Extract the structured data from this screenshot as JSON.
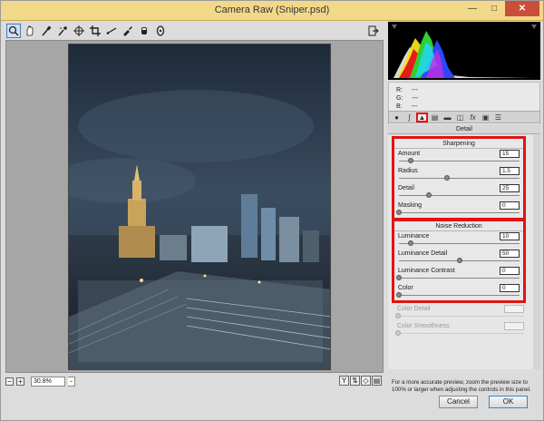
{
  "window": {
    "title": "Camera Raw (Sniper.psd)"
  },
  "toolbar": {
    "tools": [
      "zoom-icon",
      "hand-icon",
      "white-balance-icon",
      "color-sampler-icon",
      "targeted-adjust-icon",
      "crop-icon",
      "straighten-icon",
      "spot-removal-icon",
      "red-eye-icon",
      "graduated-filter-icon",
      "radial-filter-icon"
    ]
  },
  "preview": {
    "zoom_value": "30.8%"
  },
  "readout": {
    "r_label": "R:",
    "g_label": "G:",
    "b_label": "B:",
    "r": "---",
    "g": "---",
    "b": "---"
  },
  "panel": {
    "title": "Detail",
    "sharpening": {
      "title": "Sharpening",
      "sliders": [
        {
          "label": "Amount",
          "value": "15",
          "pct": 0.1
        },
        {
          "label": "Radius",
          "value": "1.5",
          "pct": 0.4
        },
        {
          "label": "Detail",
          "value": "25",
          "pct": 0.25
        },
        {
          "label": "Masking",
          "value": "0",
          "pct": 0.0
        }
      ]
    },
    "noise_reduction": {
      "title": "Noise Reduction",
      "sliders": [
        {
          "label": "Luminance",
          "value": "10",
          "pct": 0.1
        },
        {
          "label": "Luminance Detail",
          "value": "50",
          "pct": 0.5
        },
        {
          "label": "Luminance Contrast",
          "value": "0",
          "pct": 0.0
        },
        {
          "label": "Color",
          "value": "0",
          "pct": 0.0
        }
      ]
    },
    "disabled": [
      {
        "label": "Color Detail",
        "value": ""
      },
      {
        "label": "Color Smoothness",
        "value": ""
      }
    ],
    "note": "For a more accurate preview, zoom the preview size to 100% or larger when adjusting the controls in this panel."
  },
  "buttons": {
    "cancel": "Cancel",
    "ok": "OK"
  }
}
